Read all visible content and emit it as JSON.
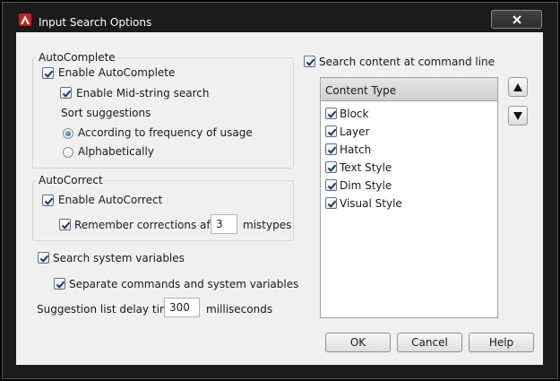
{
  "window": {
    "title": "Input Search Options"
  },
  "autocomplete": {
    "group_title": "AutoComplete",
    "enable_label": "Enable AutoComplete",
    "midstring_label": "Enable Mid-string search",
    "sort_label": "Sort suggestions",
    "sort_options": [
      "According to frequency of usage",
      "Alphabetically"
    ],
    "sort_selected": "According to frequency of usage"
  },
  "autocorrect": {
    "group_title": "AutoCorrect",
    "enable_label": "Enable AutoCorrect",
    "remember_label": "Remember corrections after",
    "remember_value": "3",
    "remember_unit": "mistypes"
  },
  "system_vars": {
    "search_label": "Search system variables",
    "separate_label": "Separate commands and system variables"
  },
  "delay": {
    "label": "Suggestion list delay time",
    "value": "300",
    "unit": "milliseconds"
  },
  "content": {
    "search_label": "Search content at command line",
    "header": "Content Type",
    "items": [
      "Block",
      "Layer",
      "Hatch",
      "Text Style",
      "Dim Style",
      "Visual Style"
    ]
  },
  "buttons": {
    "ok": "OK",
    "cancel": "Cancel",
    "help": "Help"
  },
  "icons": {
    "app": "autocad-logo-icon",
    "close": "close-icon",
    "check": "checkmark-icon",
    "up": "arrow-up-icon",
    "down": "arrow-down-icon"
  },
  "colors": {
    "title_bar": "#1b1b1b",
    "client": "#f0f0f0",
    "app_icon": "#c8201f",
    "check": "#1f3a5f"
  }
}
